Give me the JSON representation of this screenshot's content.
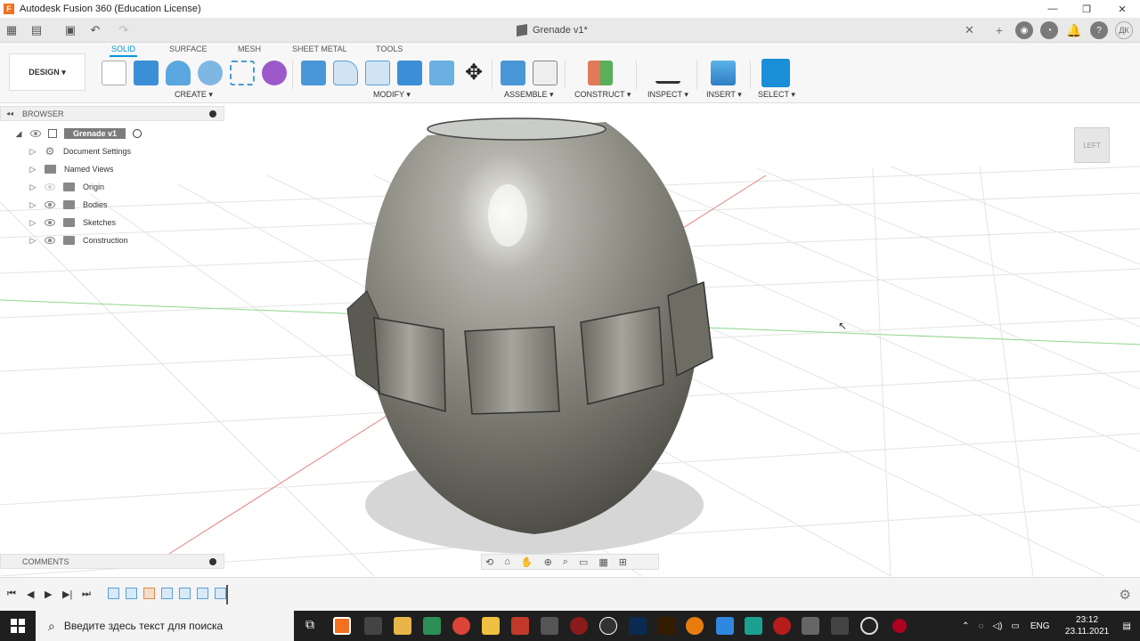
{
  "window": {
    "title": "Autodesk Fusion 360 (Education License)",
    "app_icon_letter": "F"
  },
  "document": {
    "tab_title": "Grenade v1*"
  },
  "user": {
    "initials": "ДК"
  },
  "ribbon": {
    "workspace": "DESIGN",
    "tabs": [
      "SOLID",
      "SURFACE",
      "MESH",
      "SHEET METAL",
      "TOOLS"
    ],
    "active_tab": "SOLID",
    "groups": [
      "CREATE",
      "MODIFY",
      "ASSEMBLE",
      "CONSTRUCT",
      "INSPECT",
      "INSERT",
      "SELECT"
    ]
  },
  "browser": {
    "header": "BROWSER",
    "root": "Grenade v1",
    "items": [
      {
        "label": "Document Settings",
        "icon": "gear-icon"
      },
      {
        "label": "Named Views",
        "icon": "folder-icon"
      },
      {
        "label": "Origin",
        "icon": "folder-icon"
      },
      {
        "label": "Bodies",
        "icon": "folder-icon"
      },
      {
        "label": "Sketches",
        "icon": "folder-icon"
      },
      {
        "label": "Construction",
        "icon": "folder-icon"
      }
    ]
  },
  "comments": {
    "header": "COMMENTS"
  },
  "viewcube": {
    "face": "LEFT"
  },
  "taskbar": {
    "search_placeholder": "Введите здесь текст для поиска",
    "language": "ENG",
    "time": "23:12",
    "date": "23.11.2021"
  },
  "colors": {
    "accent": "#0696d7",
    "body_metal": "#7d7c74",
    "axis_red": "#e05050",
    "axis_green": "#60c060"
  }
}
